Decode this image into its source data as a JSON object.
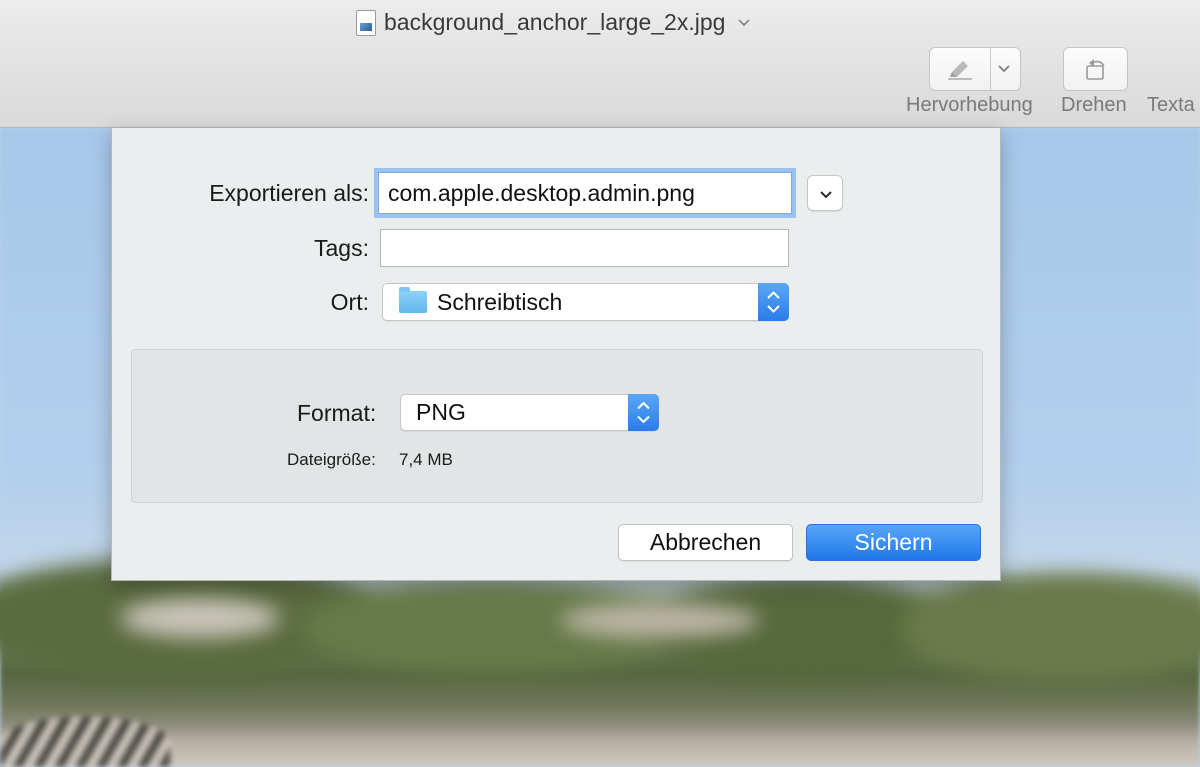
{
  "window": {
    "document_title": "background_anchor_large_2x.jpg",
    "document_icon": "jpeg-file-icon",
    "title_menu_icon": "chevron-down-icon"
  },
  "toolbar": {
    "highlight_label": "Hervorhebung",
    "highlight_icon": "highlighter-pen-icon",
    "highlight_menu_icon": "chevron-down-icon",
    "rotate_label": "Drehen",
    "rotate_icon": "rotate-left-icon",
    "text_label_partial": "Texta"
  },
  "export_dialog": {
    "export_as_label": "Exportieren als:",
    "export_as_value": "com.apple.desktop.admin.png",
    "expand_icon": "chevron-down-icon",
    "tags_label": "Tags:",
    "tags_value": "",
    "location_label": "Ort:",
    "location_value": "Schreibtisch",
    "location_icon": "folder-icon",
    "format_label": "Format:",
    "format_value": "PNG",
    "filesize_label": "Dateigröße:",
    "filesize_value": "7,4 MB",
    "cancel_label": "Abbrechen",
    "save_label": "Sichern"
  },
  "colors": {
    "accent_blue": "#2a7de6",
    "focus_ring": "#9bc2f0",
    "dialog_background": "#ebeeef"
  }
}
